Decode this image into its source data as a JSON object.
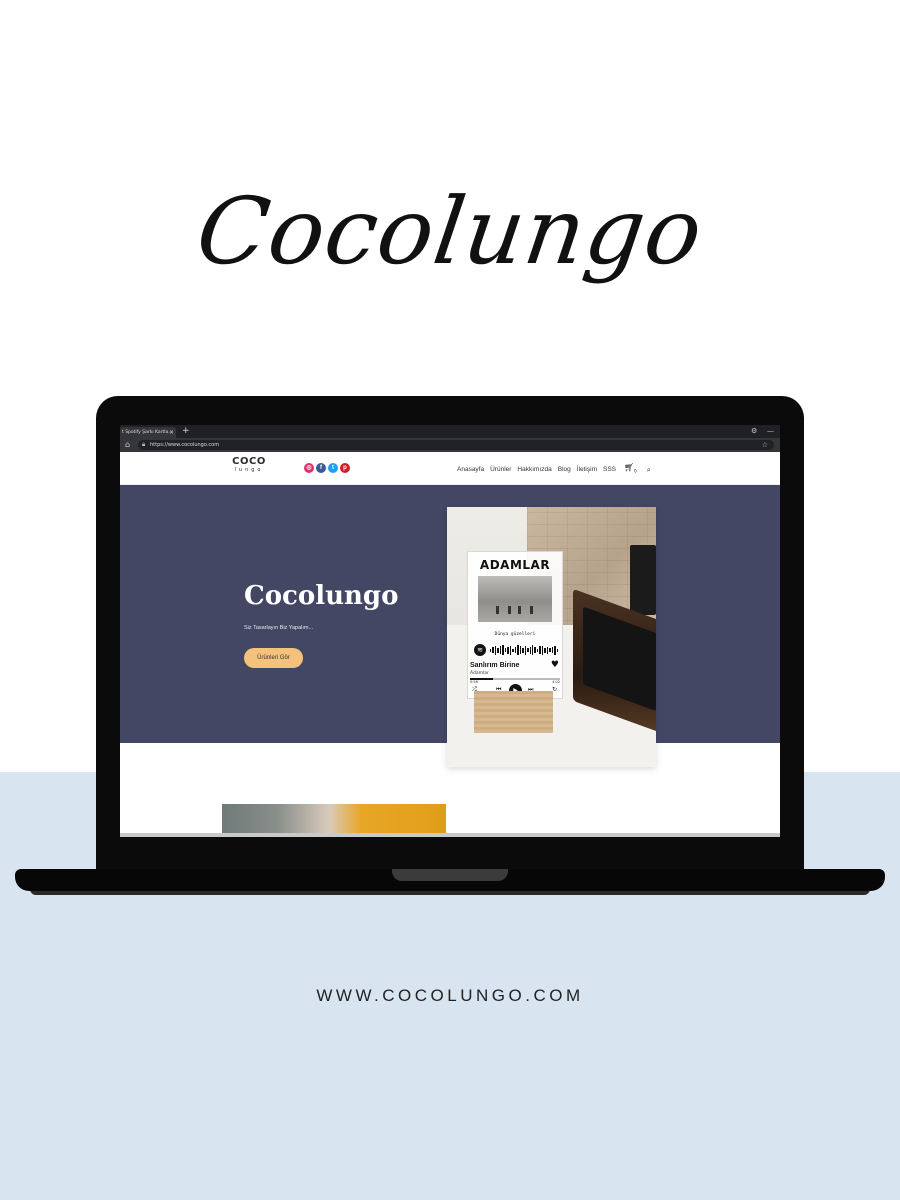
{
  "hero_brand_title": "Cocolungo",
  "footer_url": "WWW.COCOLUNGO.COM",
  "browser": {
    "tab_title": "t Spotify Şarkı Kartla...",
    "tab_close": "×",
    "new_tab": "+",
    "url": "https://www.cocolungo.com",
    "icons": {
      "home": "home-icon",
      "lock": "lock-icon",
      "star": "star-icon",
      "account": "account-icon",
      "minimize": "minimize-icon"
    }
  },
  "site": {
    "logo_top": "COCO",
    "logo_bottom": "lungo",
    "socials": [
      {
        "name": "instagram-icon",
        "glyph": "◎",
        "color": "#e1306c"
      },
      {
        "name": "facebook-icon",
        "glyph": "f",
        "color": "#3b5998"
      },
      {
        "name": "twitter-icon",
        "glyph": "t",
        "color": "#1da1f2"
      },
      {
        "name": "pinterest-icon",
        "glyph": "p",
        "color": "#cb2027"
      }
    ],
    "nav": [
      "Anasayfa",
      "Ürünler",
      "Hakkımızda",
      "Blog",
      "İletişim",
      "SSS"
    ],
    "cart_count": "0",
    "hero": {
      "title": "Cocolungo",
      "subtitle": "Siz Tasarlayın Biz Yapalım...",
      "button": "Ürünleri Gör",
      "bg_color": "#434764",
      "button_color": "#f5c27c"
    },
    "product": {
      "plaque_title": "ADAMLAR",
      "album": "Dünya güzelleri",
      "song": "Sanlırım Birine",
      "artist": "Adamlar",
      "time_start": "0:56",
      "time_end": "4:02",
      "progress": 0.25
    }
  }
}
